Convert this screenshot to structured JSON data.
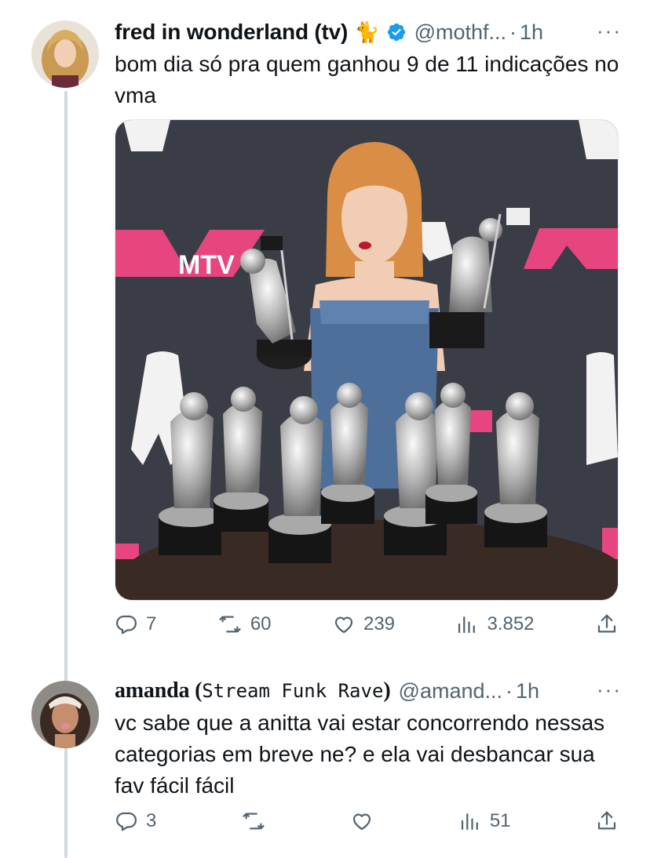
{
  "tweet1": {
    "name": "fred in wonderland (tv)",
    "emoji": "🐈",
    "handle": "@mothf...",
    "separator": "·",
    "time": "1h",
    "more": "···",
    "text": "bom dia só pra quem ganhou 9 de 11 indicações no vma",
    "media_logo": "MTV",
    "metrics": {
      "replies": "7",
      "retweets": "60",
      "likes": "239",
      "views": "3.852"
    }
  },
  "tweet2": {
    "name": "amanda",
    "name_open": " (",
    "name_suffix": "Stream Funk Rave",
    "name_close": ")",
    "handle": "@amand...",
    "separator": "·",
    "time": "1h",
    "more": "···",
    "text": "vc sabe que a anitta vai estar concorrendo nessas categorias em breve ne? e ela vai desbancar sua fav fácil fácil",
    "metrics": {
      "replies": "3",
      "views": "51"
    }
  },
  "icons": [
    "reply-icon",
    "retweet-icon",
    "like-icon",
    "views-icon",
    "share-icon",
    "verified-icon",
    "more-icon"
  ],
  "colors": {
    "verified": "#1d9bf0",
    "muted": "#536471",
    "text": "#0f1419",
    "thread": "#cfd9de",
    "mtv_pink": "#e6457f"
  }
}
